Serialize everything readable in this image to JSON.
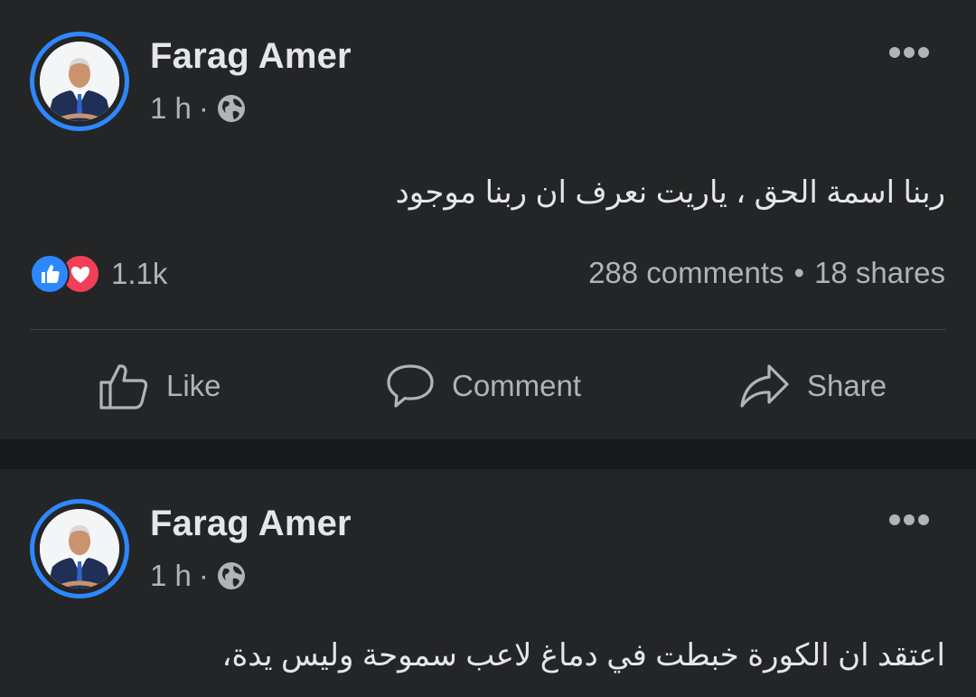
{
  "posts": [
    {
      "author": "Farag Amer",
      "time": "1 h",
      "separator": "·",
      "privacy_icon": "globe-icon",
      "text": "ربنا اسمة الحق ، ياريت نعرف ان  ربنا  موجود",
      "reactions": {
        "icons": [
          "like-icon",
          "love-icon"
        ],
        "count": "1.1k"
      },
      "comments": "288 comments",
      "stats_separator": "•",
      "shares": "18 shares",
      "actions": {
        "like": "Like",
        "comment": "Comment",
        "share": "Share"
      }
    },
    {
      "author": "Farag Amer",
      "time": "1 h",
      "separator": "·",
      "privacy_icon": "globe-icon",
      "text": "اعتقد ان الكورة خبطت في دماغ لاعب سموحة وليس يدة،"
    }
  ],
  "colors": {
    "background": "#18191a",
    "card": "#242526",
    "primary_text": "#e4e6eb",
    "secondary_text": "#b0b3b8",
    "accent": "#2d88ff",
    "love": "#f33e58",
    "divider": "#3e4042"
  }
}
